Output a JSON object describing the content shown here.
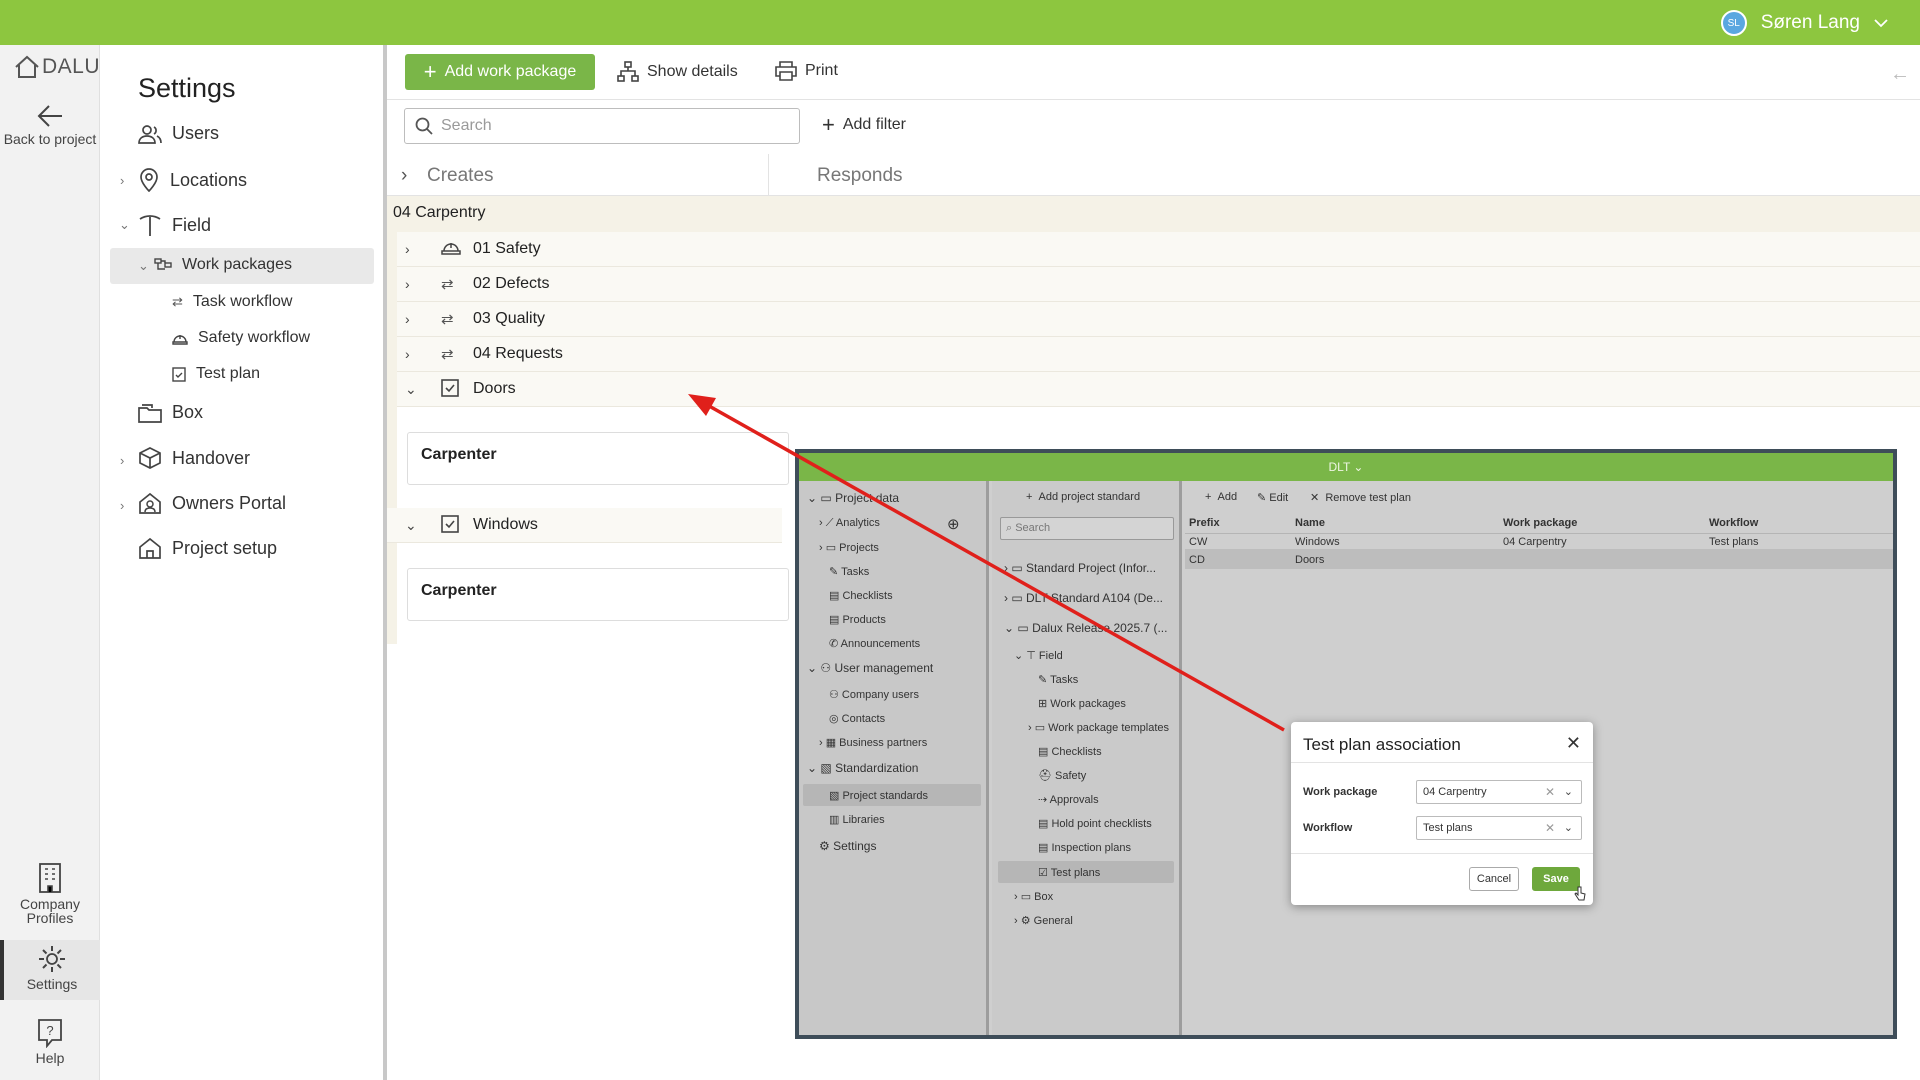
{
  "user": {
    "initials": "SL",
    "name": "Søren Lang"
  },
  "rail": {
    "logo": "DALUX",
    "back": "Back to project",
    "company": "Company Profiles",
    "settings": "Settings",
    "help": "Help"
  },
  "panel": {
    "title": "Settings",
    "items": {
      "users": "Users",
      "locations": "Locations",
      "field": "Field",
      "work_packages": "Work packages",
      "task_workflow": "Task workflow",
      "safety_workflow": "Safety workflow",
      "test_plan": "Test plan",
      "box": "Box",
      "handover": "Handover",
      "owners_portal": "Owners Portal",
      "project_setup": "Project setup"
    }
  },
  "toolbar": {
    "add_work_package": "Add work package",
    "show_details": "Show details",
    "print": "Print"
  },
  "search": {
    "placeholder": "Search"
  },
  "filter": {
    "add": "Add filter"
  },
  "tabs": {
    "creates": "Creates",
    "responds": "Responds"
  },
  "group": {
    "title": "04 Carpentry"
  },
  "rows": [
    "01 Safety",
    "02 Defects",
    "03 Quality",
    "04 Requests",
    "Doors",
    "Windows"
  ],
  "cards": [
    "Carpenter",
    "Carpenter"
  ],
  "shot": {
    "top_title": "DLT",
    "nav": {
      "project_data": "Project data",
      "analytics": "Analytics",
      "projects": "Projects",
      "tasks": "Tasks",
      "checklists": "Checklists",
      "products": "Products",
      "announcements": "Announcements",
      "user_management": "User management",
      "company_users": "Company users",
      "contacts": "Contacts",
      "business_partners": "Business partners",
      "standardization": "Standardization",
      "project_standards": "Project standards",
      "libraries": "Libraries",
      "settings": "Settings"
    },
    "list": {
      "add": "Add project standard",
      "search": "Search",
      "items": [
        "Standard Project (Infor...",
        "DLT Standard A104 (De...",
        "Dalux Release 2025.7 (...",
        "Field",
        "Tasks",
        "Work packages",
        "Work package templates",
        "Checklists",
        "Safety",
        "Approvals",
        "Hold point checklists",
        "Inspection plans",
        "Test plans",
        "Box",
        "General"
      ]
    },
    "main": {
      "add": "Add",
      "edit": "Edit",
      "remove": "Remove test plan",
      "headers": [
        "Prefix",
        "Name",
        "Work package",
        "Workflow"
      ],
      "rows": [
        [
          "CW",
          "Windows",
          "04 Carpentry",
          "Test plans"
        ],
        [
          "CD",
          "Doors",
          "",
          ""
        ]
      ]
    },
    "dialog": {
      "title": "Test plan association",
      "work_package_label": "Work package",
      "work_package_value": "04 Carpentry",
      "workflow_label": "Workflow",
      "workflow_value": "Test plans",
      "cancel": "Cancel",
      "save": "Save"
    }
  },
  "colors": {
    "brand": "#8dc63f",
    "primary_button": "#7ab648",
    "annotation_arrow": "#e0201b"
  }
}
